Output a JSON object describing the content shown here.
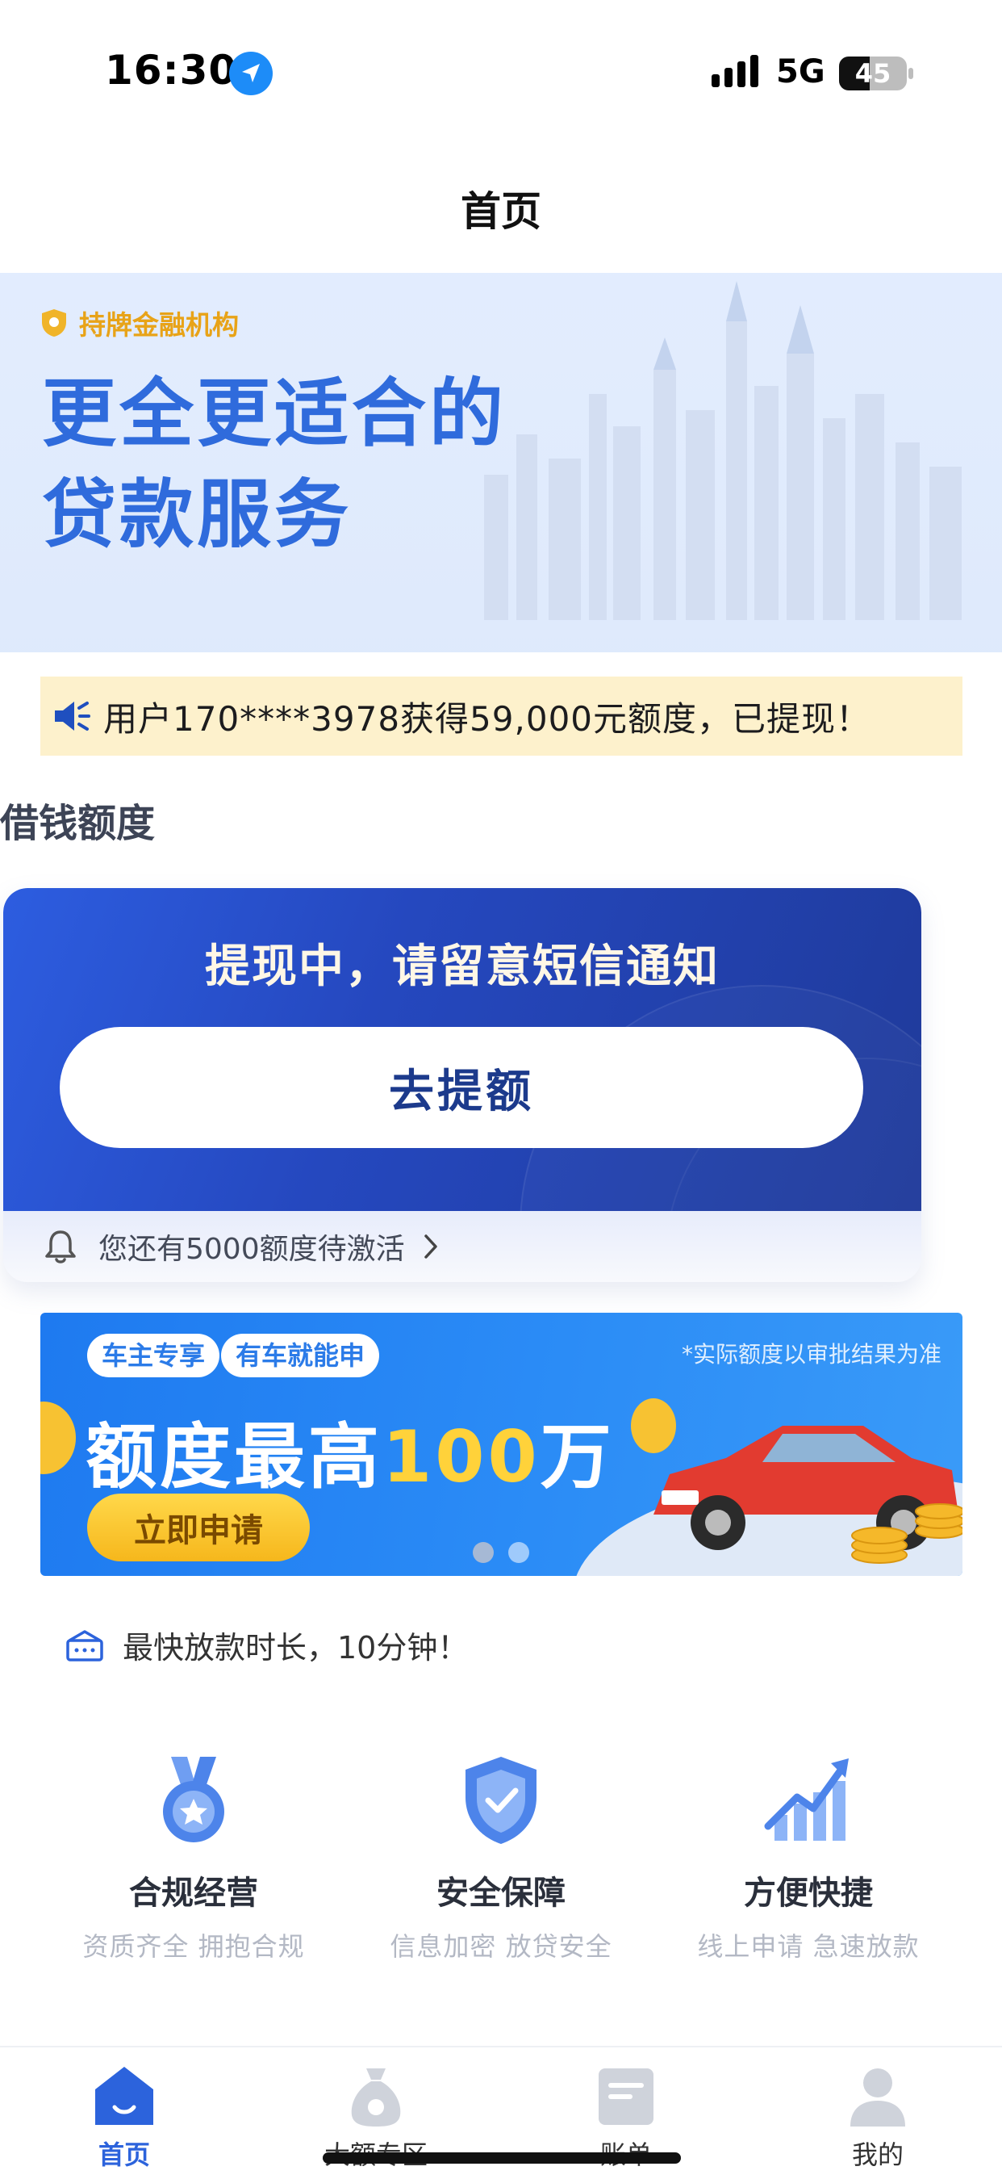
{
  "status_bar": {
    "time": "16:30",
    "network": "5G",
    "battery": "45",
    "battery_level": 0.45
  },
  "nav": {
    "title": "首页"
  },
  "hero": {
    "badge": "持牌金融机构",
    "line1": "更全更适合的",
    "line2": "贷款服务"
  },
  "notice": {
    "text": "用户170****3978获得59,000元额度，已提现！"
  },
  "section": {
    "title": "借钱额度"
  },
  "loan_card": {
    "status": "提现中，请留意短信通知",
    "button": "去提额",
    "pending": "您还有5000额度待激活"
  },
  "promo": {
    "tag1": "车主专享",
    "tag2": "有车就能申",
    "note": "*实际额度以审批结果为准",
    "headline_prefix": "额度最高",
    "headline_highlight": "100",
    "headline_suffix": "万",
    "apply": "立即申请"
  },
  "speed": {
    "text": "最快放款时长，10分钟！"
  },
  "features": [
    {
      "title": "合规经营",
      "desc": "资质齐全 拥抱合规",
      "icon": "medal-icon"
    },
    {
      "title": "安全保障",
      "desc": "信息加密 放贷安全",
      "icon": "shield-check-icon"
    },
    {
      "title": "方便快捷",
      "desc": "线上申请 急速放款",
      "icon": "growth-chart-icon"
    }
  ],
  "tabs": [
    {
      "label": "首页",
      "icon": "home-icon",
      "active": true
    },
    {
      "label": "大额专区",
      "icon": "money-bag-icon",
      "active": false
    },
    {
      "label": "账单",
      "icon": "bill-icon",
      "active": false
    },
    {
      "label": "我的",
      "icon": "user-icon",
      "active": false
    }
  ],
  "colors": {
    "brand_blue": "#2c63dc",
    "hero_text": "#2f6bdc",
    "badge_gold": "#e8a318",
    "notice_bg": "#fdf1cc",
    "promo_highlight": "#ffd23a"
  }
}
